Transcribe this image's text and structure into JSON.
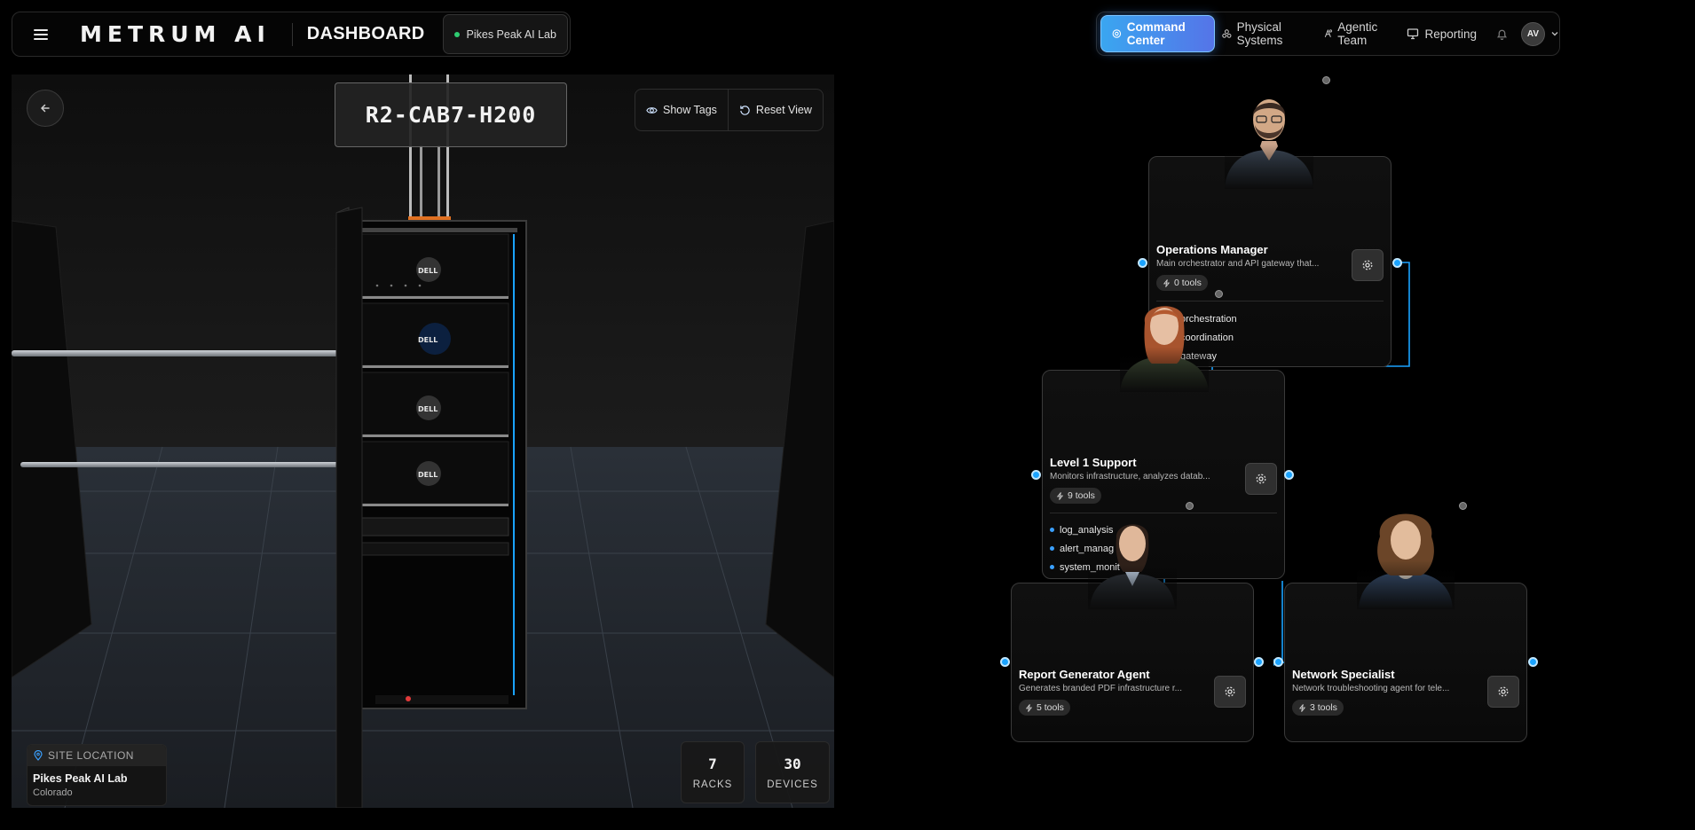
{
  "header": {
    "logo_text": "METRUM AI",
    "title": "DASHBOARD",
    "lab_chip": "Pikes Peak AI Lab"
  },
  "nav": {
    "items": [
      {
        "label": "Command Center",
        "icon": "command-icon",
        "active": true
      },
      {
        "label": "Physical Systems",
        "icon": "systems-icon",
        "active": false
      },
      {
        "label": "Agentic Team",
        "icon": "agentic-icon",
        "active": false
      },
      {
        "label": "Reporting",
        "icon": "monitor-icon",
        "active": false
      }
    ],
    "avatar_initials": "AV"
  },
  "viewport": {
    "rack_label": "R2-CAB7-H200",
    "show_tags_label": "Show Tags",
    "reset_view_label": "Reset View",
    "site_location_label": "SITE LOCATION",
    "site_name": "Pikes Peak AI Lab",
    "site_state": "Colorado",
    "stats": [
      {
        "value": "7",
        "label": "RACKS"
      },
      {
        "value": "30",
        "label": "DEVICES"
      }
    ],
    "server_brand": "DELL"
  },
  "agents": [
    {
      "name": "Operations Manager",
      "description": "Main orchestrator and API gateway that...",
      "tools": "0  tools",
      "capabilities": [
        "orchestration",
        "coordination",
        "gateway"
      ]
    },
    {
      "name": "Level 1 Support",
      "description": "Monitors infrastructure, analyzes datab...",
      "tools": "9  tools",
      "capabilities": [
        "log_analysis",
        "alert_manag",
        "system_monit"
      ]
    },
    {
      "name": "Report Generator Agent",
      "description": "Generates branded PDF infrastructure r...",
      "tools": "5  tools"
    },
    {
      "name": "Network Specialist",
      "description": "Network troubleshooting agent for tele...",
      "tools": "3  tools"
    }
  ],
  "colors": {
    "accent": "#1aa3ff",
    "active_nav_start": "#3aa6f0",
    "active_nav_end": "#5574e8",
    "status_green": "#2ecc71"
  }
}
